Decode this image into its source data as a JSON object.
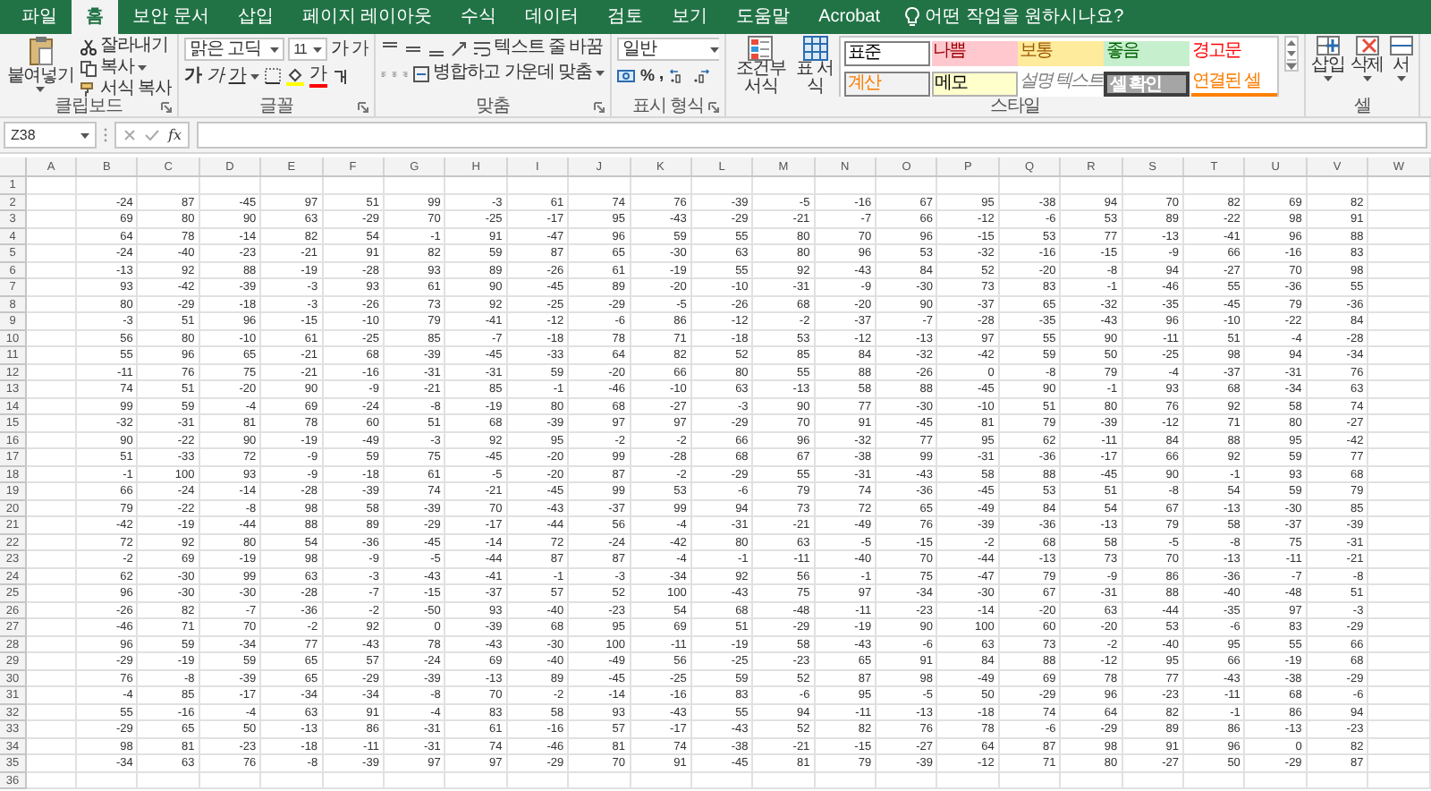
{
  "tabs": [
    {
      "label": "파일",
      "selected": false
    },
    {
      "label": "홈",
      "selected": true
    },
    {
      "label": "보안 문서",
      "selected": false
    },
    {
      "label": "삽입",
      "selected": false
    },
    {
      "label": "페이지 레이아웃",
      "selected": false
    },
    {
      "label": "수식",
      "selected": false
    },
    {
      "label": "데이터",
      "selected": false
    },
    {
      "label": "검토",
      "selected": false
    },
    {
      "label": "보기",
      "selected": false
    },
    {
      "label": "도움말",
      "selected": false
    },
    {
      "label": "Acrobat",
      "selected": false
    }
  ],
  "tell_me": "어떤 작업을 원하시나요?",
  "ribbon": {
    "clipboard": {
      "label": "클립보드",
      "paste": "붙여넣기",
      "cut": "잘라내기",
      "copy": "복사",
      "format_painter": "서식 복사"
    },
    "font": {
      "label": "글꼴",
      "font_name": "맑은 고딕",
      "font_size": "11",
      "size_buttons": [
        "가",
        "가"
      ],
      "style_buttons": [
        {
          "kind": "bold",
          "text": "가"
        },
        {
          "kind": "italic",
          "text": "가"
        },
        {
          "kind": "underline",
          "text": "가"
        }
      ],
      "font_color": "가"
    },
    "alignment": {
      "label": "맞춤",
      "wrap_text": "텍스트 줄 바꿈",
      "merge_center": "병합하고 가운데 맞춤"
    },
    "number": {
      "label": "표시 형식",
      "format": "일반",
      "percent": "%",
      "comma": ","
    },
    "styles": {
      "label": "스타일",
      "conditional_formatting": "조건부 서식",
      "format_as_table": "표 서식",
      "cell_styles": [
        {
          "text": "표준",
          "kind": "normal"
        },
        {
          "text": "나쁨",
          "kind": "bad"
        },
        {
          "text": "보통",
          "kind": "neutral"
        },
        {
          "text": "좋음",
          "kind": "good"
        },
        {
          "text": "경고문",
          "kind": "warning"
        },
        {
          "text": "계산",
          "kind": "calculation"
        },
        {
          "text": "메모",
          "kind": "note"
        },
        {
          "text": "설명 텍스트",
          "kind": "explanatory"
        },
        {
          "text": "셀 확인",
          "kind": "check"
        },
        {
          "text": "연결된 셀",
          "kind": "linked"
        }
      ]
    },
    "cells": {
      "label": "셀",
      "buttons": [
        "삽입",
        "삭제",
        "서"
      ]
    }
  },
  "formula_bar": {
    "name_box": "Z38",
    "function_label": "fx"
  },
  "columns": [
    "A",
    "B",
    "C",
    "D",
    "E",
    "F",
    "G",
    "H",
    "I",
    "J",
    "K",
    "L",
    "M",
    "N",
    "O",
    "P",
    "Q",
    "R",
    "S",
    "T",
    "U",
    "V",
    "W"
  ],
  "rows": [
    {
      "number": "1"
    },
    {
      "number": "2",
      "cells": [
        "-24",
        "87",
        "-45",
        "97",
        "51",
        "99",
        "-3",
        "61",
        "74",
        "76",
        "-39",
        "-5",
        "-16",
        "67",
        "95",
        "-38",
        "94",
        "70",
        "82",
        "69",
        "82"
      ]
    },
    {
      "number": "3",
      "cells": [
        "69",
        "80",
        "90",
        "63",
        "-29",
        "70",
        "-25",
        "-17",
        "95",
        "-43",
        "-29",
        "-21",
        "-7",
        "66",
        "-12",
        "-6",
        "53",
        "89",
        "-22",
        "98",
        "91"
      ]
    },
    {
      "number": "4",
      "cells": [
        "64",
        "78",
        "-14",
        "82",
        "54",
        "-1",
        "91",
        "-47",
        "96",
        "59",
        "55",
        "80",
        "70",
        "96",
        "-15",
        "53",
        "77",
        "-13",
        "-41",
        "96",
        "88"
      ]
    },
    {
      "number": "5",
      "cells": [
        "-24",
        "-40",
        "-23",
        "-21",
        "91",
        "82",
        "59",
        "87",
        "65",
        "-30",
        "63",
        "80",
        "96",
        "53",
        "-32",
        "-16",
        "-15",
        "-9",
        "66",
        "-16",
        "83"
      ]
    },
    {
      "number": "6",
      "cells": [
        "-13",
        "92",
        "88",
        "-19",
        "-28",
        "93",
        "89",
        "-26",
        "61",
        "-19",
        "55",
        "92",
        "-43",
        "84",
        "52",
        "-20",
        "-8",
        "94",
        "-27",
        "70",
        "98"
      ]
    },
    {
      "number": "7",
      "cells": [
        "93",
        "-42",
        "-39",
        "-3",
        "93",
        "61",
        "90",
        "-45",
        "89",
        "-20",
        "-10",
        "-31",
        "-9",
        "-30",
        "73",
        "83",
        "-1",
        "-46",
        "55",
        "-36",
        "55"
      ]
    },
    {
      "number": "8",
      "cells": [
        "80",
        "-29",
        "-18",
        "-3",
        "-26",
        "73",
        "92",
        "-25",
        "-29",
        "-5",
        "-26",
        "68",
        "-20",
        "90",
        "-37",
        "65",
        "-32",
        "-35",
        "-45",
        "79",
        "-36"
      ]
    },
    {
      "number": "9",
      "cells": [
        "-3",
        "51",
        "96",
        "-15",
        "-10",
        "79",
        "-41",
        "-12",
        "-6",
        "86",
        "-12",
        "-2",
        "-37",
        "-7",
        "-28",
        "-35",
        "-43",
        "96",
        "-10",
        "-22",
        "84"
      ]
    },
    {
      "number": "10",
      "cells": [
        "56",
        "80",
        "-10",
        "61",
        "-25",
        "85",
        "-7",
        "-18",
        "78",
        "71",
        "-18",
        "53",
        "-12",
        "-13",
        "97",
        "55",
        "90",
        "-11",
        "51",
        "-4",
        "-28"
      ]
    },
    {
      "number": "11",
      "cells": [
        "55",
        "96",
        "65",
        "-21",
        "68",
        "-39",
        "-45",
        "-33",
        "64",
        "82",
        "52",
        "85",
        "84",
        "-32",
        "-42",
        "59",
        "50",
        "-25",
        "98",
        "94",
        "-34"
      ]
    },
    {
      "number": "12",
      "cells": [
        "-11",
        "76",
        "75",
        "-21",
        "-16",
        "-31",
        "-31",
        "59",
        "-20",
        "66",
        "80",
        "55",
        "88",
        "-26",
        "0",
        "-8",
        "79",
        "-4",
        "-37",
        "-31",
        "76"
      ]
    },
    {
      "number": "13",
      "cells": [
        "74",
        "51",
        "-20",
        "90",
        "-9",
        "-21",
        "85",
        "-1",
        "-46",
        "-10",
        "63",
        "-13",
        "58",
        "88",
        "-45",
        "90",
        "-1",
        "93",
        "68",
        "-34",
        "63"
      ]
    },
    {
      "number": "14",
      "cells": [
        "99",
        "59",
        "-4",
        "69",
        "-24",
        "-8",
        "-19",
        "80",
        "68",
        "-27",
        "-3",
        "90",
        "77",
        "-30",
        "-10",
        "51",
        "80",
        "76",
        "92",
        "58",
        "74"
      ]
    },
    {
      "number": "15",
      "cells": [
        "-32",
        "-31",
        "81",
        "78",
        "60",
        "51",
        "68",
        "-39",
        "97",
        "97",
        "-29",
        "70",
        "91",
        "-45",
        "81",
        "79",
        "-39",
        "-12",
        "71",
        "80",
        "-27"
      ]
    },
    {
      "number": "16",
      "cells": [
        "90",
        "-22",
        "90",
        "-19",
        "-49",
        "-3",
        "92",
        "95",
        "-2",
        "-2",
        "66",
        "96",
        "-32",
        "77",
        "95",
        "62",
        "-11",
        "84",
        "88",
        "95",
        "-42"
      ]
    },
    {
      "number": "17",
      "cells": [
        "51",
        "-33",
        "72",
        "-9",
        "59",
        "75",
        "-45",
        "-20",
        "99",
        "-28",
        "68",
        "67",
        "-38",
        "99",
        "-31",
        "-36",
        "-17",
        "66",
        "92",
        "59",
        "77"
      ]
    },
    {
      "number": "18",
      "cells": [
        "-1",
        "100",
        "93",
        "-9",
        "-18",
        "61",
        "-5",
        "-20",
        "87",
        "-2",
        "-29",
        "55",
        "-31",
        "-43",
        "58",
        "88",
        "-45",
        "90",
        "-1",
        "93",
        "68"
      ]
    },
    {
      "number": "19",
      "cells": [
        "66",
        "-24",
        "-14",
        "-28",
        "-39",
        "74",
        "-21",
        "-45",
        "99",
        "53",
        "-6",
        "79",
        "74",
        "-36",
        "-45",
        "53",
        "51",
        "-8",
        "54",
        "59",
        "79"
      ]
    },
    {
      "number": "20",
      "cells": [
        "79",
        "-22",
        "-8",
        "98",
        "58",
        "-39",
        "70",
        "-43",
        "-37",
        "99",
        "94",
        "73",
        "72",
        "65",
        "-49",
        "84",
        "54",
        "67",
        "-13",
        "-30",
        "85"
      ]
    },
    {
      "number": "21",
      "cells": [
        "-42",
        "-19",
        "-44",
        "88",
        "89",
        "-29",
        "-17",
        "-44",
        "56",
        "-4",
        "-31",
        "-21",
        "-49",
        "76",
        "-39",
        "-36",
        "-13",
        "79",
        "58",
        "-37",
        "-39"
      ]
    },
    {
      "number": "22",
      "cells": [
        "72",
        "92",
        "80",
        "54",
        "-36",
        "-45",
        "-14",
        "72",
        "-24",
        "-42",
        "80",
        "63",
        "-5",
        "-15",
        "-2",
        "68",
        "58",
        "-5",
        "-8",
        "75",
        "-31"
      ]
    },
    {
      "number": "23",
      "cells": [
        "-2",
        "69",
        "-19",
        "98",
        "-9",
        "-5",
        "-44",
        "87",
        "87",
        "-4",
        "-1",
        "-11",
        "-40",
        "70",
        "-44",
        "-13",
        "73",
        "70",
        "-13",
        "-11",
        "-21"
      ]
    },
    {
      "number": "24",
      "cells": [
        "62",
        "-30",
        "99",
        "63",
        "-3",
        "-43",
        "-41",
        "-1",
        "-3",
        "-34",
        "92",
        "56",
        "-1",
        "75",
        "-47",
        "79",
        "-9",
        "86",
        "-36",
        "-7",
        "-8"
      ]
    },
    {
      "number": "25",
      "cells": [
        "96",
        "-30",
        "-30",
        "-28",
        "-7",
        "-15",
        "-37",
        "57",
        "52",
        "100",
        "-43",
        "75",
        "97",
        "-34",
        "-30",
        "67",
        "-31",
        "88",
        "-40",
        "-48",
        "51"
      ]
    },
    {
      "number": "26",
      "cells": [
        "-26",
        "82",
        "-7",
        "-36",
        "-2",
        "-50",
        "93",
        "-40",
        "-23",
        "54",
        "68",
        "-48",
        "-11",
        "-23",
        "-14",
        "-20",
        "63",
        "-44",
        "-35",
        "97",
        "-3"
      ]
    },
    {
      "number": "27",
      "cells": [
        "-46",
        "71",
        "70",
        "-2",
        "92",
        "0",
        "-39",
        "68",
        "95",
        "69",
        "51",
        "-29",
        "-19",
        "90",
        "100",
        "60",
        "-20",
        "53",
        "-6",
        "83",
        "-29"
      ]
    },
    {
      "number": "28",
      "cells": [
        "96",
        "59",
        "-34",
        "77",
        "-43",
        "78",
        "-43",
        "-30",
        "100",
        "-11",
        "-19",
        "58",
        "-43",
        "-6",
        "63",
        "73",
        "-2",
        "-40",
        "95",
        "55",
        "66"
      ]
    },
    {
      "number": "29",
      "cells": [
        "-29",
        "-19",
        "59",
        "65",
        "57",
        "-24",
        "69",
        "-40",
        "-49",
        "56",
        "-25",
        "-23",
        "65",
        "91",
        "84",
        "88",
        "-12",
        "95",
        "66",
        "-19",
        "68"
      ]
    },
    {
      "number": "30",
      "cells": [
        "76",
        "-8",
        "-39",
        "65",
        "-29",
        "-39",
        "-13",
        "89",
        "-45",
        "-25",
        "59",
        "52",
        "87",
        "98",
        "-49",
        "69",
        "78",
        "77",
        "-43",
        "-38",
        "-29"
      ]
    },
    {
      "number": "31",
      "cells": [
        "-4",
        "85",
        "-17",
        "-34",
        "-34",
        "-8",
        "70",
        "-2",
        "-14",
        "-16",
        "83",
        "-6",
        "95",
        "-5",
        "50",
        "-29",
        "96",
        "-23",
        "-11",
        "68",
        "-6"
      ]
    },
    {
      "number": "32",
      "cells": [
        "55",
        "-16",
        "-4",
        "63",
        "91",
        "-4",
        "83",
        "58",
        "93",
        "-43",
        "55",
        "94",
        "-11",
        "-13",
        "-18",
        "74",
        "64",
        "82",
        "-1",
        "86",
        "94"
      ]
    },
    {
      "number": "33",
      "cells": [
        "-29",
        "65",
        "50",
        "-13",
        "86",
        "-31",
        "61",
        "-16",
        "57",
        "-17",
        "-43",
        "52",
        "82",
        "76",
        "78",
        "-6",
        "-29",
        "89",
        "86",
        "-13",
        "-23"
      ]
    },
    {
      "number": "34",
      "cells": [
        "98",
        "81",
        "-23",
        "-18",
        "-11",
        "-31",
        "74",
        "-46",
        "81",
        "74",
        "-38",
        "-21",
        "-15",
        "-27",
        "64",
        "87",
        "98",
        "91",
        "96",
        "0",
        "82"
      ]
    },
    {
      "number": "35",
      "cells": [
        "-34",
        "63",
        "76",
        "-8",
        "-39",
        "97",
        "97",
        "-29",
        "70",
        "91",
        "-45",
        "81",
        "79",
        "-39",
        "-12",
        "71",
        "80",
        "-27",
        "50",
        "-29",
        "87"
      ]
    },
    {
      "number": "36"
    }
  ]
}
